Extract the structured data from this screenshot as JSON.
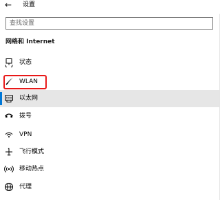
{
  "titlebar": {
    "back_label": "←",
    "title": "设置"
  },
  "search": {
    "placeholder": "查找设置"
  },
  "section": {
    "title": "网络和 Internet"
  },
  "nav": [
    {
      "label": "状态",
      "icon": "status-icon"
    },
    {
      "label": "WLAN",
      "icon": "wifi-icon"
    },
    {
      "label": "以太网",
      "icon": "ethernet-icon",
      "selected": true
    },
    {
      "label": "拨号",
      "icon": "dialup-icon"
    },
    {
      "label": "VPN",
      "icon": "vpn-icon"
    },
    {
      "label": "飞行模式",
      "icon": "airplane-icon"
    },
    {
      "label": "移动热点",
      "icon": "hotspot-icon"
    },
    {
      "label": "代理",
      "icon": "proxy-icon"
    }
  ],
  "colors": {
    "accent": "#0078d7",
    "selected_bg": "#e6e6e6",
    "annotation": "#e81818"
  }
}
